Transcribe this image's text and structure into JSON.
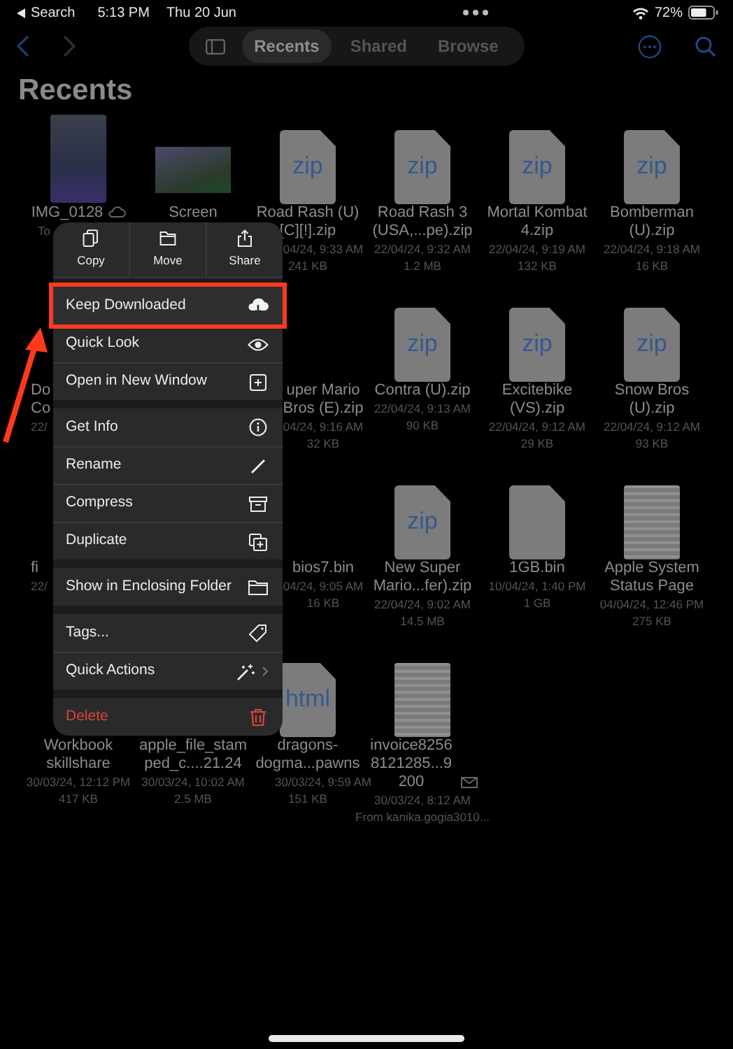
{
  "status_bar": {
    "back_label": "Search",
    "time": "5:13 PM",
    "date": "Thu 20 Jun",
    "battery": "72%"
  },
  "toolbar": {
    "tabs": [
      {
        "label": "Recents",
        "selected": true
      },
      {
        "label": "Shared",
        "selected": false
      },
      {
        "label": "Browse",
        "selected": false
      }
    ]
  },
  "title": "Recents",
  "files": [
    {
      "kind": "portrait_image",
      "name": "IMG_0128",
      "badge": true,
      "date": "To"
    },
    {
      "kind": "landscape_image",
      "name": "Screen"
    },
    {
      "kind": "document",
      "icon_label": "zip",
      "name": "Road Rash (U) [C][!].zip",
      "date": "04/24, 9:33 AM",
      "size": "241 KB"
    },
    {
      "kind": "document",
      "icon_label": "zip",
      "name": "Road Rash 3 (USA,...pe).zip",
      "date": "22/04/24, 9:32 AM",
      "size": "1.2 MB"
    },
    {
      "kind": "document",
      "icon_label": "zip",
      "name": "Mortal Kombat 4.zip",
      "date": "22/04/24, 9:19 AM",
      "size": "132 KB"
    },
    {
      "kind": "document",
      "icon_label": "zip",
      "name": "Bomberman (U).zip",
      "date": "22/04/24, 9:18 AM",
      "size": "16 KB"
    },
    {
      "kind": "covered_left",
      "lines": [
        "Do",
        "Co",
        "22/"
      ]
    },
    {
      "kind": "hidden"
    },
    {
      "kind": "covered_right",
      "lines": [
        "uper Mario",
        "Bros (E).zip",
        "04/24, 9:16 AM",
        "32 KB"
      ]
    },
    {
      "kind": "document",
      "icon_label": "zip",
      "name": "Contra (U).zip",
      "date": "22/04/24, 9:13 AM",
      "size": "90 KB"
    },
    {
      "kind": "document",
      "icon_label": "zip",
      "name": "Excitebike (VS).zip",
      "date": "22/04/24, 9:12 AM",
      "size": "29 KB"
    },
    {
      "kind": "document",
      "icon_label": "zip",
      "name": "Snow Bros (U).zip",
      "date": "22/04/24, 9:12 AM",
      "size": "93 KB"
    },
    {
      "kind": "covered_left",
      "lines": [
        "fi",
        "22/"
      ]
    },
    {
      "kind": "hidden"
    },
    {
      "kind": "covered_right",
      "lines": [
        "bios7.bin",
        "04/24, 9:05 AM",
        "16 KB"
      ]
    },
    {
      "kind": "document",
      "icon_label": "zip",
      "name": "New Super Mario...fer).zip",
      "date": "22/04/24, 9:02 AM",
      "size": "14.5 MB"
    },
    {
      "kind": "document",
      "name": "1GB.bin",
      "date": "10/04/24, 1:40 PM",
      "size": "1 GB"
    },
    {
      "kind": "page_image",
      "name": "Apple System Status Page",
      "date": "04/04/24, 12:46 PM",
      "size": "275 KB"
    },
    {
      "kind": "text_only",
      "name": "Workbook skillshare",
      "date": "30/03/24, 12:12 PM",
      "size": "417 KB"
    },
    {
      "kind": "text_only",
      "name": "apple_file_stam ped_c....21.24",
      "date": "30/03/24, 10:02 AM",
      "size": "2.5 MB"
    },
    {
      "kind": "document",
      "icon_label": "html",
      "name": "dragons-dogma...pawns",
      "date": "30/03/24, 9:59 AM",
      "size": "151 KB"
    },
    {
      "kind": "page_image",
      "name": "invoice82568121285...9200",
      "badge": true,
      "date": "30/03/24, 8:12 AM",
      "size": "From kanika.gogia3010..."
    }
  ],
  "menu": {
    "actions": [
      {
        "label": "Copy"
      },
      {
        "label": "Move"
      },
      {
        "label": "Share"
      }
    ],
    "groups": [
      {
        "items": [
          {
            "label": "Keep Downloaded",
            "kind": "normal",
            "highlighted": true
          },
          {
            "label": "Quick Look",
            "kind": "normal",
            "highlighted": false
          },
          {
            "label": "Open in New Window",
            "kind": "normal",
            "highlighted": false
          }
        ]
      },
      {
        "items": [
          {
            "label": "Get Info",
            "kind": "normal",
            "highlighted": false
          },
          {
            "label": "Rename",
            "kind": "normal",
            "highlighted": false
          },
          {
            "label": "Compress",
            "kind": "normal",
            "highlighted": false
          },
          {
            "label": "Duplicate",
            "kind": "normal",
            "highlighted": false
          }
        ]
      },
      {
        "items": [
          {
            "label": "Show in Enclosing Folder",
            "kind": "normal",
            "highlighted": false
          }
        ]
      },
      {
        "items": [
          {
            "label": "Tags...",
            "kind": "normal",
            "highlighted": false
          },
          {
            "label": "Quick Actions",
            "kind": "submenu",
            "highlighted": false
          }
        ]
      },
      {
        "items": [
          {
            "label": "Delete",
            "kind": "destructive",
            "highlighted": false
          }
        ]
      }
    ]
  }
}
